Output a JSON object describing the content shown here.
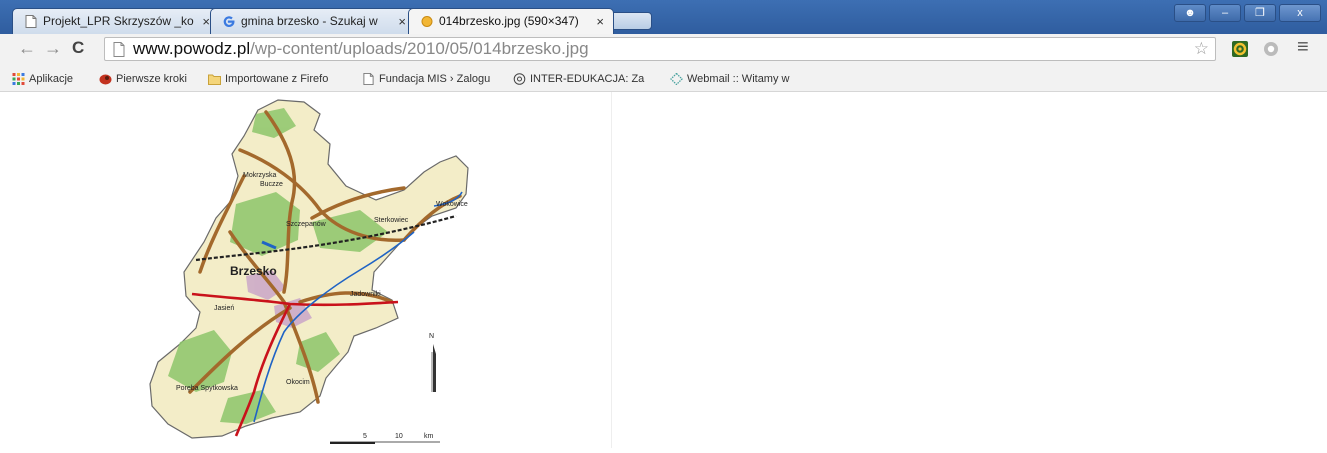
{
  "tabs": [
    {
      "label": "Projekt_LPR Skrzyszów _ko",
      "icon": "page-icon",
      "close": "×"
    },
    {
      "label": "gmina brzesko - Szukaj w",
      "icon": "google-icon",
      "close": "×"
    },
    {
      "label": "014brzesko.jpg (590×347)",
      "icon": "image-icon",
      "close": "×",
      "active": true
    }
  ],
  "toolbar": {
    "back": "←",
    "forward": "→",
    "reload": "C",
    "url_host": "www.powodz.pl",
    "url_path": "/wp-content/uploads/2010/05/014brzesko.jpg",
    "star": "☆",
    "menu": "≡"
  },
  "bookmarks": [
    {
      "label": "Aplikacje",
      "icon": "apps-grid-icon"
    },
    {
      "label": "Pierwsze kroki",
      "icon": "firefox-icon"
    },
    {
      "label": "Importowane z Firefo",
      "icon": "folder-icon"
    },
    {
      "label": "Fundacja MIS › Zalogu",
      "icon": "page-icon"
    },
    {
      "label": "INTER-EDUKACJA: Za",
      "icon": "globe-icon"
    },
    {
      "label": "Webmail :: Witamy w",
      "icon": "webmail-icon"
    }
  ],
  "map": {
    "places": {
      "mokrzyska": "Mokrzyska",
      "buczze": "Buczze",
      "szczepanow": "Szczepanów",
      "wokowice": "Wokowice",
      "sterkowiec": "Sterkowiec",
      "brzesko": "Brzesko",
      "jasien": "Jasień",
      "jadowniki": "Jadowniki",
      "okocim": "Okocim",
      "poreba": "Poręba Spytkowska"
    },
    "north": "N",
    "scale": {
      "t1": "5",
      "t2": "10",
      "unit": "km"
    }
  },
  "colors": {
    "tabstrip": "#2f5d9f",
    "land": "#f3edc8",
    "forest": "#8dc66b",
    "road_main": "#c9121b",
    "road_secondary": "#a3692c",
    "water": "#1f63c5"
  }
}
